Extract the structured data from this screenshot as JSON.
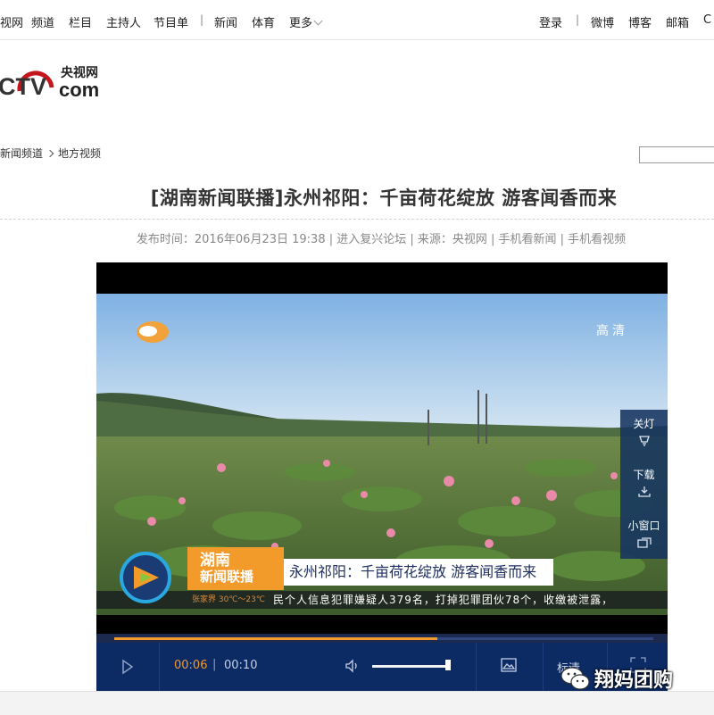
{
  "topnav": {
    "items": [
      "视网",
      "频道",
      "栏目",
      "主持人",
      "节目单",
      "新闻",
      "体育",
      "更多"
    ],
    "right": [
      "登录",
      "微博",
      "博客",
      "邮箱"
    ]
  },
  "logo": {
    "big": "CTV",
    "cn": "央视网",
    "com": "com"
  },
  "breadcrumb": {
    "section": "新闻频道",
    "sub": "地方视频"
  },
  "article": {
    "title": "[湖南新闻联播]永州祁阳：千亩荷花绽放 游客闻香而来",
    "meta": "发布时间：2016年06月23日 19:38 | 进入复兴论坛 | 来源：央视网 | 手机看新闻 | 手机看视频"
  },
  "player": {
    "quality_badge": "高清",
    "side": {
      "lights": "关灯",
      "download": "下载",
      "mini": "小窗口"
    },
    "lowerthird": {
      "brand_line1": "湖南",
      "brand_line2": "新闻联播",
      "headline": "永州祁阳：千亩荷花绽放 游客闻香而来",
      "weather": "张家界 30℃～23℃",
      "ticker": "民个人信息犯罪嫌疑人379名，打掉犯罪团伙78个，收缴被泄露，"
    },
    "time_current": "00:06",
    "time_sep": "|",
    "time_total": "00:10",
    "progress": 0.6,
    "volume": 1.0,
    "quality_button": "标清"
  },
  "watermark": "翔妈团购",
  "colors": {
    "accent": "#f29a2a",
    "player_bar": "#0c2a64"
  }
}
